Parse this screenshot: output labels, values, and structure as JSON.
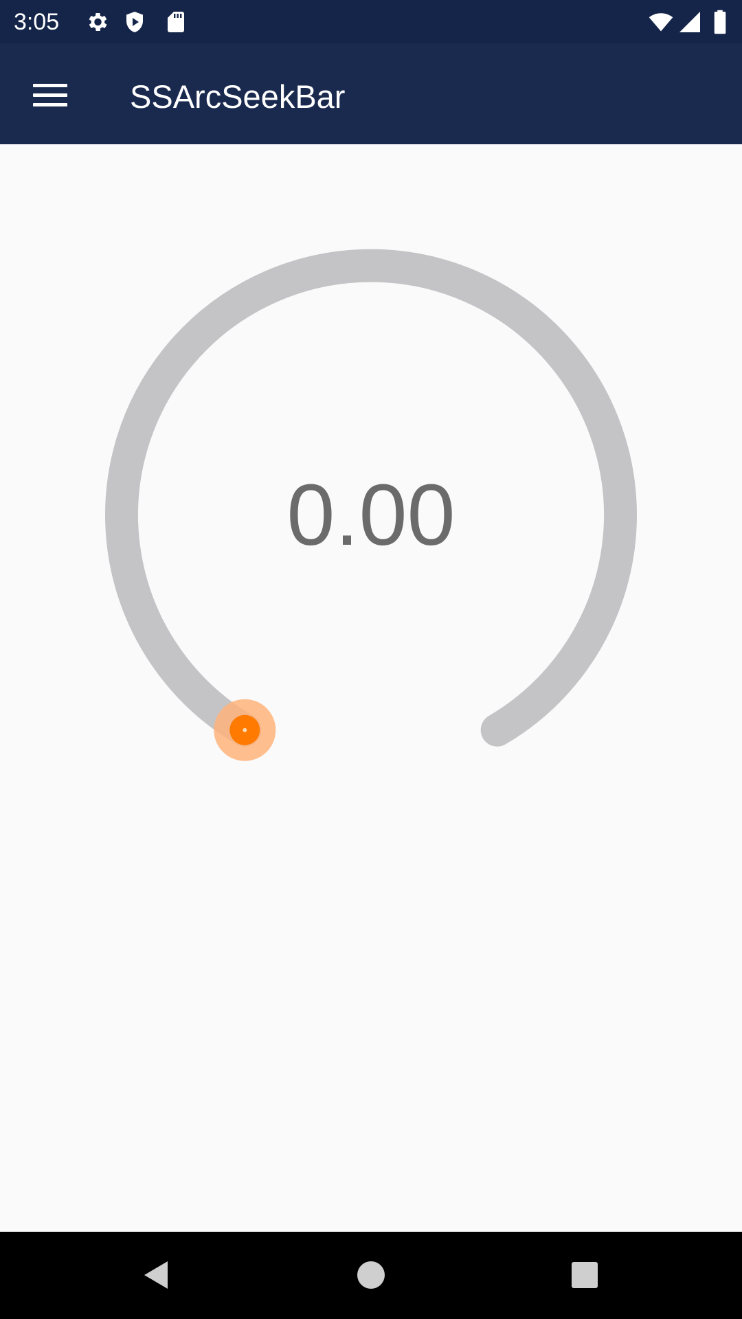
{
  "status_bar": {
    "time": "3:05",
    "left_icons": [
      "settings-gear-icon",
      "play-protect-icon",
      "sd-card-icon"
    ],
    "right_icons": [
      "wifi-icon",
      "cell-signal-icon",
      "battery-icon"
    ]
  },
  "app_bar": {
    "title": "SSArcSeekBar",
    "menu_icon": "hamburger-menu-icon"
  },
  "arc_seek_bar": {
    "value_text": "0.00",
    "progress": 0,
    "track_color": "#c4c4c7",
    "thumb_color": "#ff7a00",
    "thumb_halo_color": "#ffb37a",
    "value_color": "#6b6b6b"
  },
  "nav_bar": {
    "buttons": [
      "back-icon",
      "home-icon",
      "recents-icon"
    ]
  },
  "colors": {
    "status_bar": "#15254a",
    "app_bar": "#1a2a4f",
    "background": "#fafafa",
    "nav_bar": "#000000"
  }
}
